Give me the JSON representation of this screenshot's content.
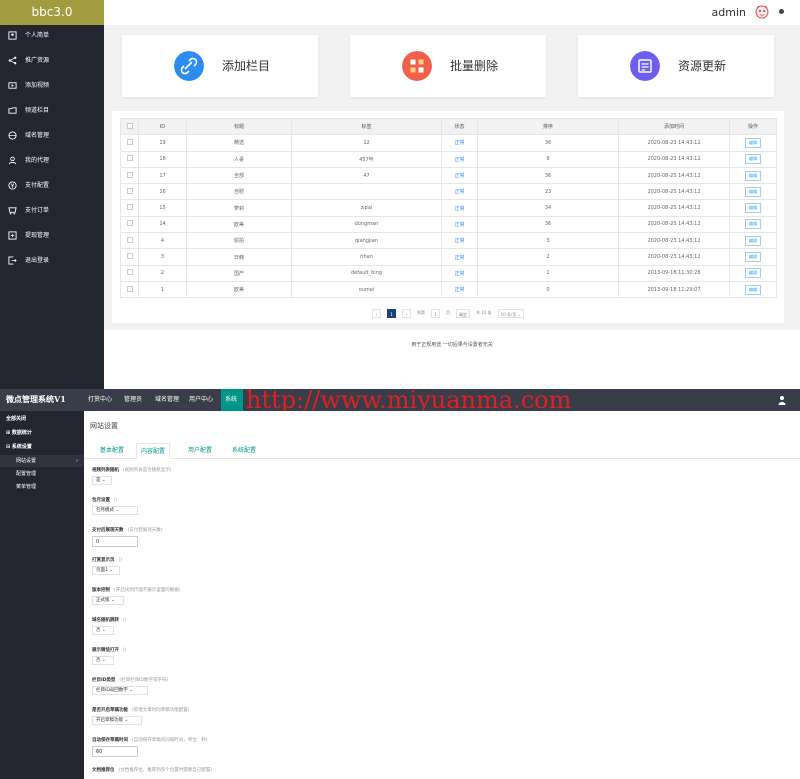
{
  "top": {
    "brand": "bbc3.0",
    "user": "admin",
    "sidebar": [
      {
        "label": "个人简单",
        "icon": "profile-icon"
      },
      {
        "label": "推广资源",
        "icon": "share-icon"
      },
      {
        "label": "添加视频",
        "icon": "video-icon"
      },
      {
        "label": "频道栏目",
        "icon": "folder-icon"
      },
      {
        "label": "域名管理",
        "icon": "globe-icon"
      },
      {
        "label": "我的代理",
        "icon": "user-icon"
      },
      {
        "label": "支付配置",
        "icon": "payment-icon"
      },
      {
        "label": "支付订单",
        "icon": "order-icon"
      },
      {
        "label": "提现管理",
        "icon": "withdraw-icon"
      },
      {
        "label": "退出登录",
        "icon": "logout-icon"
      }
    ],
    "cards": [
      {
        "label": "添加栏目",
        "icon": "link-icon",
        "color": "#2d8cf0"
      },
      {
        "label": "批量删除",
        "icon": "grid-icon",
        "color": "#f0604d"
      },
      {
        "label": "资源更新",
        "icon": "list-icon",
        "color": "#6d5ef0"
      }
    ],
    "table": {
      "headers": [
        "",
        "ID",
        "标题",
        "标签",
        "状态",
        "排序",
        "添加时间",
        "操作"
      ],
      "rows": [
        {
          "id": "19",
          "title": "精选",
          "tag": "12",
          "status": "正常",
          "sort": "36",
          "time": "2020-08-23 14:43:12",
          "action": "编辑"
        },
        {
          "id": "18",
          "title": "人妻",
          "tag": "457咔",
          "status": "正常",
          "sort": "9",
          "time": "2020-08-23 14:43:12",
          "action": "编辑"
        },
        {
          "id": "17",
          "title": "全部",
          "tag": "47",
          "status": "正常",
          "sort": "36",
          "time": "2020-08-23 14:43:12",
          "action": "编辑"
        },
        {
          "id": "16",
          "title": "自慰",
          "tag": "",
          "status": "正常",
          "sort": "23",
          "time": "2020-08-23 14:43:12",
          "action": "编辑"
        },
        {
          "id": "15",
          "title": "萝莉",
          "tag": "zipai",
          "status": "正常",
          "sort": "34",
          "time": "2020-08-23 14:43:12",
          "action": "编辑"
        },
        {
          "id": "14",
          "title": "欧美",
          "tag": "dongman",
          "status": "正常",
          "sort": "36",
          "time": "2020-08-23 14:43:12",
          "action": "编辑"
        },
        {
          "id": "4",
          "title": "偷拍",
          "tag": "qiangjian",
          "status": "正常",
          "sort": "3",
          "time": "2020-08-23 14:43:12",
          "action": "编辑"
        },
        {
          "id": "3",
          "title": "日韩",
          "tag": "rihan",
          "status": "正常",
          "sort": "2",
          "time": "2020-08-23 14:43:12",
          "action": "编辑"
        },
        {
          "id": "2",
          "title": "国产",
          "tag": "default_bing",
          "status": "正常",
          "sort": "1",
          "time": "2013-09-18 11:30:28",
          "action": "编辑"
        },
        {
          "id": "1",
          "title": "欧美",
          "tag": "oumei",
          "status": "正常",
          "sort": "0",
          "time": "2013-09-18 11:29:07",
          "action": "编辑"
        }
      ]
    },
    "pager": {
      "prev": "‹",
      "current": "1",
      "next": "›",
      "goto_label": "到第",
      "page_value": "1",
      "page_unit": "页",
      "confirm": "确定",
      "total": "共 10 条",
      "per_page": "10 条/页"
    },
    "footer": "用于正规用途 一切后果与设置者无关"
  },
  "bottom": {
    "title": "微点管理系统V1",
    "nav": [
      "打赏中心",
      "管理员",
      "域名管理",
      "用户中心",
      "系统"
    ],
    "watermark": "http://www.miyuanma.com",
    "sidebar": [
      {
        "label": "全部关闭"
      },
      {
        "label": "⊞ 数据统计"
      },
      {
        "label": "⊟ 系统设置"
      },
      {
        "label": "网站设置",
        "arrow": "›"
      },
      {
        "label": "配置管理"
      },
      {
        "label": "菜单管理"
      }
    ],
    "page_title": "网站设置",
    "tabs": [
      "基本配置",
      "内容配置",
      "用户配置",
      "系统配置"
    ],
    "fields": [
      {
        "label": "视频列表随机",
        "hint": "(视频列表是否随机显示)",
        "value": "是",
        "type": "select"
      },
      {
        "label": "包月设置",
        "hint": "()",
        "value": "包月模式",
        "type": "select"
      },
      {
        "label": "支付后展现天数",
        "hint": "(支付后展现天数)",
        "value": "0",
        "type": "input"
      },
      {
        "label": "打赏显示页",
        "hint": "()",
        "value": "页面1",
        "type": "select"
      },
      {
        "label": "版本控制",
        "hint": "(开启块到代理不展示里面的数据)",
        "value": "正式版",
        "type": "select"
      },
      {
        "label": "域名随机跳转",
        "hint": "()",
        "value": "否",
        "type": "select"
      },
      {
        "label": "展示微信打开",
        "hint": "()",
        "value": "否",
        "type": "select"
      },
      {
        "label": "栏目ID类型",
        "hint": "(栏目栏目ID数字或字符)",
        "value": "栏目ID返回数字",
        "type": "select"
      },
      {
        "label": "是否开启草稿功能",
        "hint": "(新增文章时的草稿功能配置)",
        "value": "开启草稿功能",
        "type": "select"
      },
      {
        "label": "自动保存草稿时间",
        "hint": "(自动保存草稿的间隔时间，单位：秒)",
        "value": "60",
        "type": "input"
      },
      {
        "label": "文档推荐位",
        "hint": "(文档推荐位，推荐到多个位置时需要自己配置)",
        "value": "",
        "type": "label"
      }
    ]
  }
}
